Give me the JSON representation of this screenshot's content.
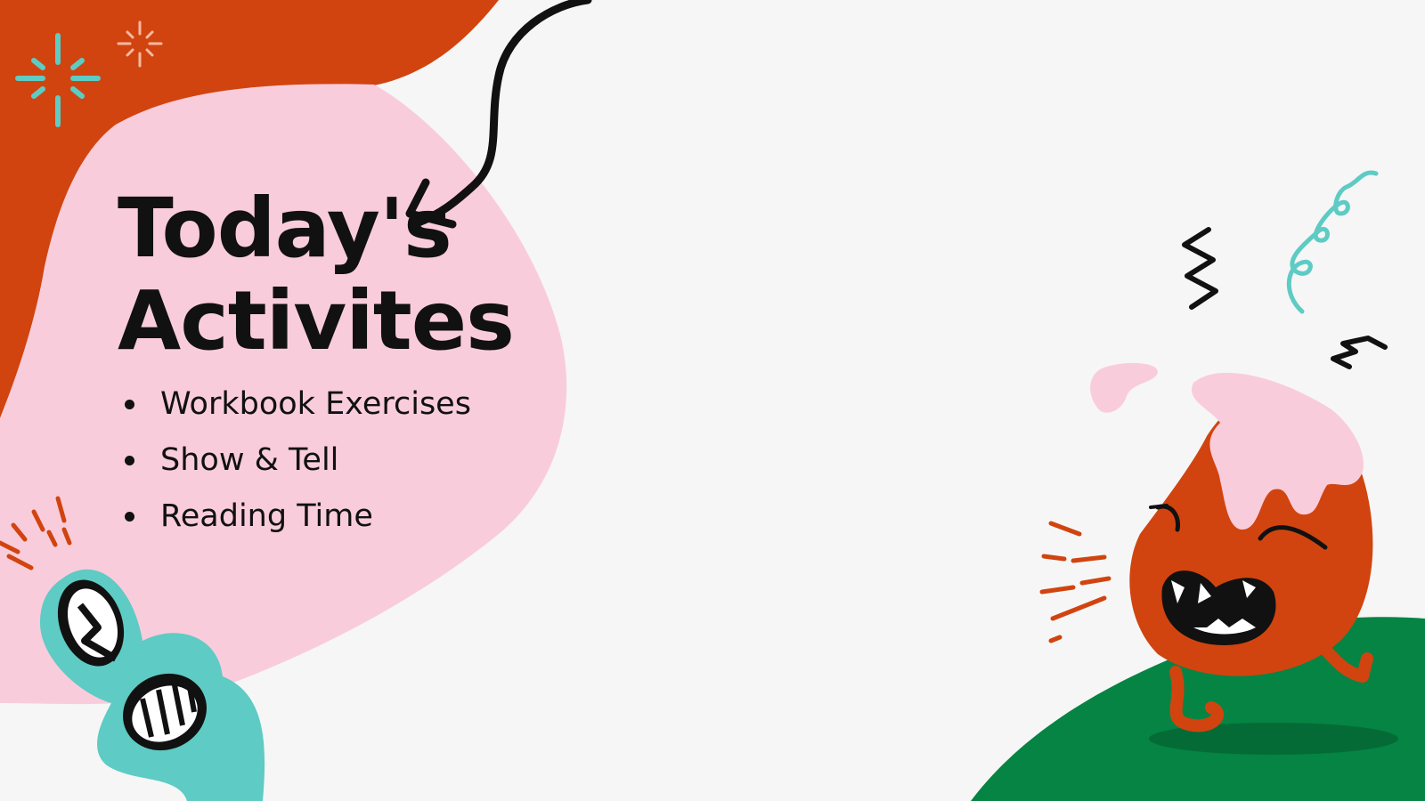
{
  "slide": {
    "title_line1": "Today's",
    "title_line2": "Activites",
    "activities": [
      "Workbook Exercises",
      "Show & Tell",
      "Reading Time"
    ]
  },
  "colors": {
    "background": "#f6f6f6",
    "orange": "#d1440f",
    "pink": "#f9ccdc",
    "teal": "#5ecbc4",
    "green": "#058443",
    "ink": "#111111"
  },
  "decorations": {
    "icons": [
      "sparkle-icon",
      "curved-arrow-icon",
      "zigzag-icon",
      "squiggle-icon",
      "teal-monster-icon",
      "fire-monster-icon"
    ]
  }
}
